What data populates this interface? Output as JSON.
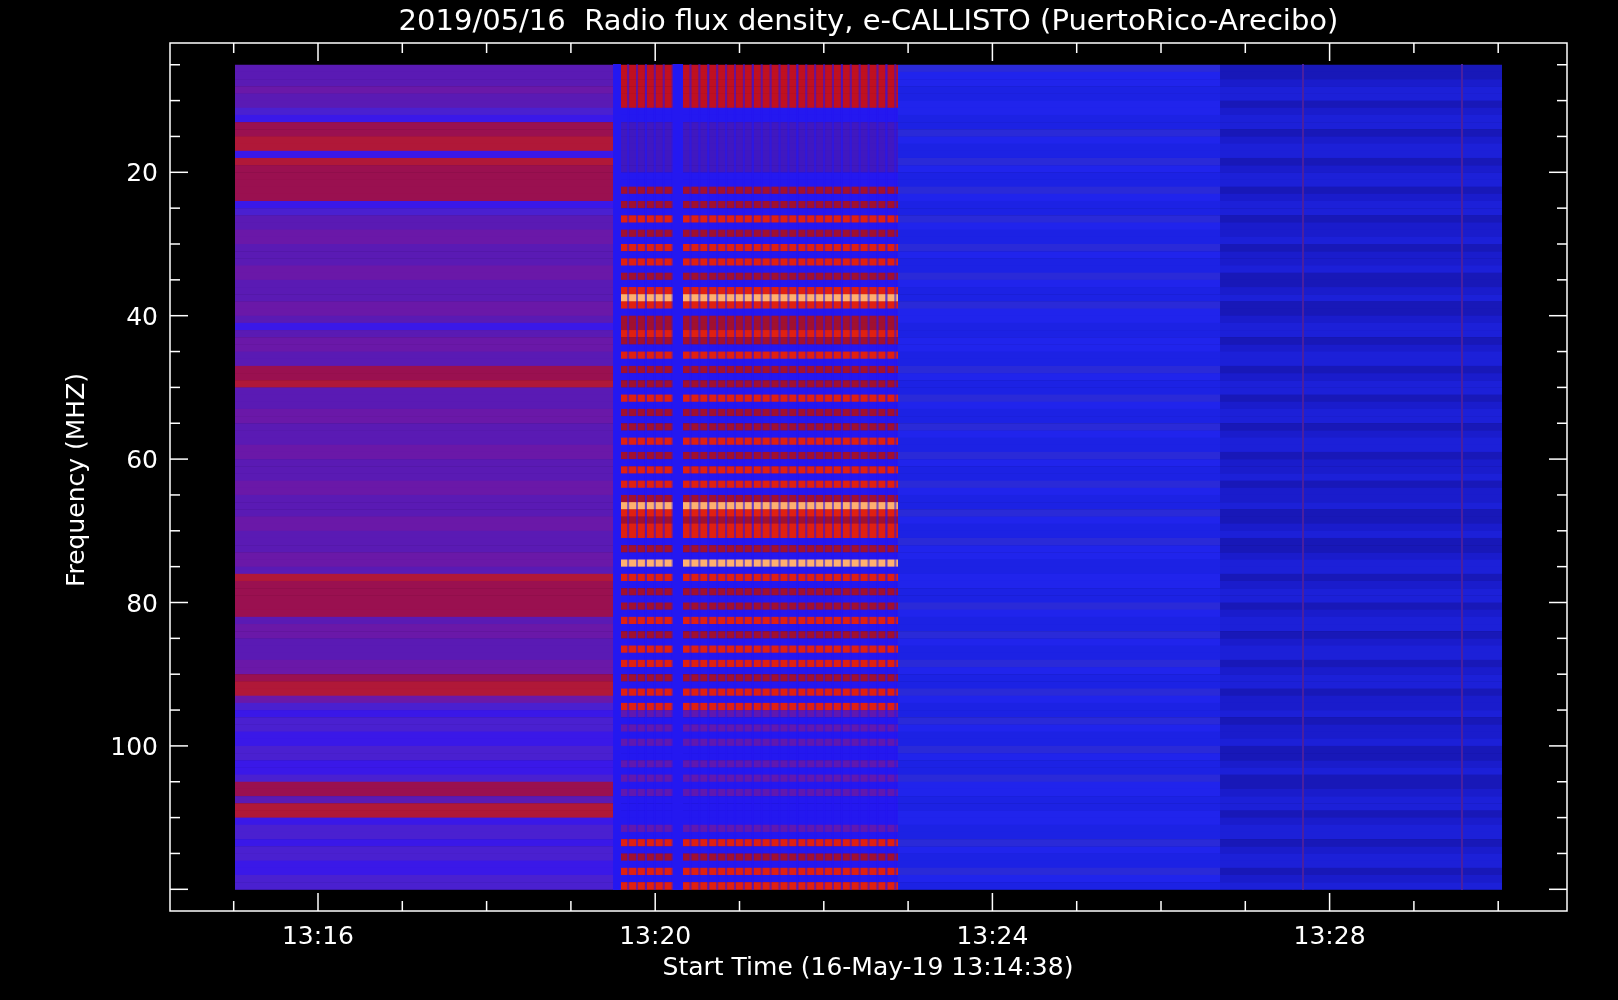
{
  "figure": {
    "title": "2019/05/16  Radio flux density, e-CALLISTO (PuertoRico-Arecibo)",
    "ylabel": "Frequency (MHZ)",
    "xlabel": "Start Time (16-May-19 13:14:38)",
    "yticks": [
      "20",
      "40",
      "60",
      "80",
      "100"
    ],
    "xticks": [
      "13:16",
      "13:20",
      "13:24",
      "13:28"
    ]
  }
}
